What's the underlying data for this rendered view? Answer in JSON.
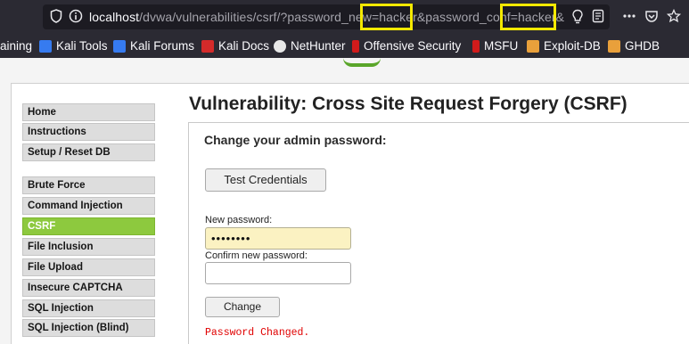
{
  "browser": {
    "url": {
      "host": "localhost",
      "path": "/dvwa/vulnerabilities/csrf/?password_new=hacker&password_conf=hacker&"
    },
    "highlight_color": "#f5e900",
    "icons": {
      "shield": "shield-icon",
      "info": "info-icon",
      "lightbulb": "lightbulb-icon",
      "reader": "reader-view-icon",
      "more": "more-icon",
      "pocket": "pocket-icon",
      "star": "star-icon"
    },
    "bookmarks": [
      {
        "label": "aining",
        "icon": null
      },
      {
        "label": "Kali Tools",
        "icon": "kali-dragon-icon"
      },
      {
        "label": "Kali Forums",
        "icon": "kali-dragon-icon"
      },
      {
        "label": "Kali Docs",
        "icon": "kali-docs-icon"
      },
      {
        "label": "NetHunter",
        "icon": "nethunter-icon"
      },
      {
        "label": "Offensive Security",
        "icon": "offsec-icon"
      },
      {
        "label": "MSFU",
        "icon": "offsec-icon"
      },
      {
        "label": "Exploit-DB",
        "icon": "exploitdb-icon"
      },
      {
        "label": "GHDB",
        "icon": "exploitdb-icon"
      }
    ]
  },
  "sidebar": {
    "items": [
      {
        "label": "Home",
        "selected": false
      },
      {
        "label": "Instructions",
        "selected": false
      },
      {
        "label": "Setup / Reset DB",
        "selected": false
      },
      {
        "label": "Brute Force",
        "selected": false
      },
      {
        "label": "Command Injection",
        "selected": false
      },
      {
        "label": "CSRF",
        "selected": true
      },
      {
        "label": "File Inclusion",
        "selected": false
      },
      {
        "label": "File Upload",
        "selected": false
      },
      {
        "label": "Insecure CAPTCHA",
        "selected": false
      },
      {
        "label": "SQL Injection",
        "selected": false
      },
      {
        "label": "SQL Injection (Blind)",
        "selected": false
      }
    ],
    "selected_color": "#8dc93e"
  },
  "main": {
    "title": "Vulnerability: Cross Site Request Forgery (CSRF)",
    "section_title": "Change your admin password:",
    "test_credentials_label": "Test Credentials",
    "new_password_label": "New password:",
    "new_password_value": "••••••••",
    "confirm_password_label": "Confirm new password:",
    "confirm_password_value": "",
    "change_label": "Change",
    "status_message": "Password Changed.",
    "status_color": "#e00000"
  }
}
